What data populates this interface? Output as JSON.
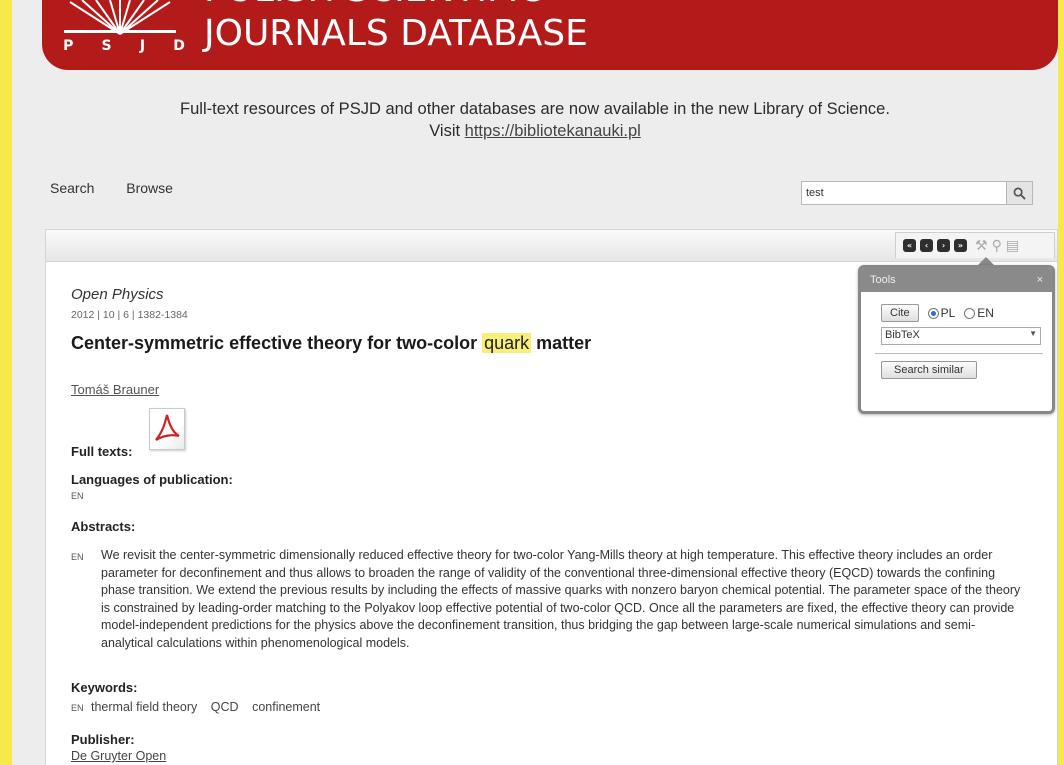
{
  "colors": {
    "brand_red": "#b31b1b",
    "highlight": "#f8ef7a",
    "frame_yellow": "#f6ea4a"
  },
  "header": {
    "logo_letters": [
      "P",
      "S",
      "J",
      "D"
    ],
    "title_line1": "POLISH SCIENTIFIC",
    "title_line2": "JOURNALS DATABASE"
  },
  "notice": {
    "line1": "Full-text resources of PSJD and other databases are now available in the new Library of Science.",
    "visit_label": "Visit",
    "link": "https://bibliotekanauki.pl"
  },
  "nav": {
    "search": "Search",
    "browse": "Browse"
  },
  "search": {
    "value": "test",
    "icon": "search-icon"
  },
  "toolbar": {
    "nav_icons": [
      "first-icon",
      "prev-icon",
      "next-icon",
      "last-icon"
    ],
    "tool_icons": [
      "tools-icon",
      "link-icon",
      "print-icon"
    ]
  },
  "article": {
    "journal": "Open Physics",
    "meta": "2012 | 10 | 6 | 1382-1384",
    "title_before": "Center-symmetric effective theory for two-color ",
    "title_highlight": "quark",
    "title_after": " matter",
    "author": "Tomáš Brauner",
    "full_texts_label": "Full texts:",
    "languages_label": "Languages of publication:",
    "language_code": "EN",
    "abstracts_label": "Abstracts:",
    "abstract_code": "EN",
    "abstract_text": "We revisit the center-symmetric dimensionally reduced effective theory for two-color Yang-Mills theory at high temperature. This effective theory includes an order parameter for deconfinement and thus allows to broaden the range of validity of the conventional three-dimensional effective theory (EQCD) towards the confining phase transition. We extend the previous results by including the effects of massive quarks with nonzero baryon chemical potential. The parameter space of the theory is constrained by leading-order matching to the Polyakov loop effective potential of two-color QCD. Once all the parameters are fixed, the effective theory can provide model-independent predictions for the physics above the deconfinement transition, thus bridging the gap between large-scale numerical simulations and semi-analytical calculations within phenomenological models.",
    "keywords_label": "Keywords:",
    "keywords_code": "EN",
    "keywords": [
      "thermal field theory",
      "QCD",
      "confinement"
    ],
    "publisher_label": "Publisher:",
    "publisher": "De Gruyter Open"
  },
  "tools_panel": {
    "title": "Tools",
    "close": "×",
    "cite_button": "Cite",
    "lang_pl": "PL",
    "lang_en": "EN",
    "selected_lang": "PL",
    "format_selected": "BibTeX",
    "search_similar_button": "Search similar"
  }
}
